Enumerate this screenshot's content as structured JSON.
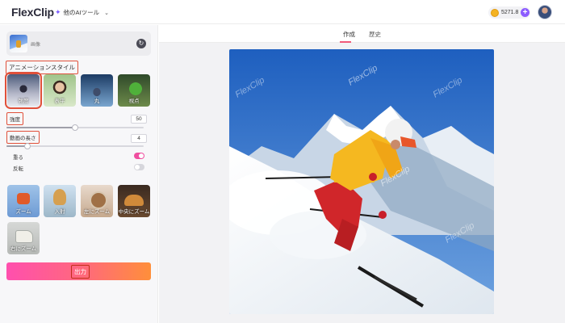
{
  "header": {
    "logo": "FlexClip",
    "tools_label": "他のAIツール",
    "credits": "5271.8"
  },
  "left_panel": {
    "image_label": "画像",
    "style_section_title": "アニメーションスタイル",
    "styles": [
      {
        "label": "強度",
        "selected": true
      },
      {
        "label": "表平",
        "selected": false
      },
      {
        "label": "丸",
        "selected": false
      },
      {
        "label": "視点",
        "selected": false
      }
    ],
    "params": {
      "intensity_label": "強度",
      "intensity_value": "50",
      "intensity_fraction": 0.5,
      "duration_label": "動画の長さ",
      "duration_value": "4",
      "duration_fraction": 0.15,
      "loop_label": "重る",
      "loop_on": true,
      "reverse_label": "反転",
      "reverse_on": false
    },
    "motions": [
      {
        "label": "ズーム"
      },
      {
        "label": "入射"
      },
      {
        "label": "左にズーム"
      },
      {
        "label": "中央にズーム"
      },
      {
        "label": "右にズーム"
      }
    ],
    "export_label": "出力"
  },
  "main": {
    "tabs": [
      "作成",
      "歴史"
    ],
    "active_tab": "作成",
    "watermark": "FlexClip"
  },
  "colors": {
    "accent": "#e0503a",
    "toggle_on": "#ef4fa0",
    "export_start": "#ff4fae",
    "export_end": "#ff8f3a",
    "tab_underline": "#f05a7a"
  }
}
